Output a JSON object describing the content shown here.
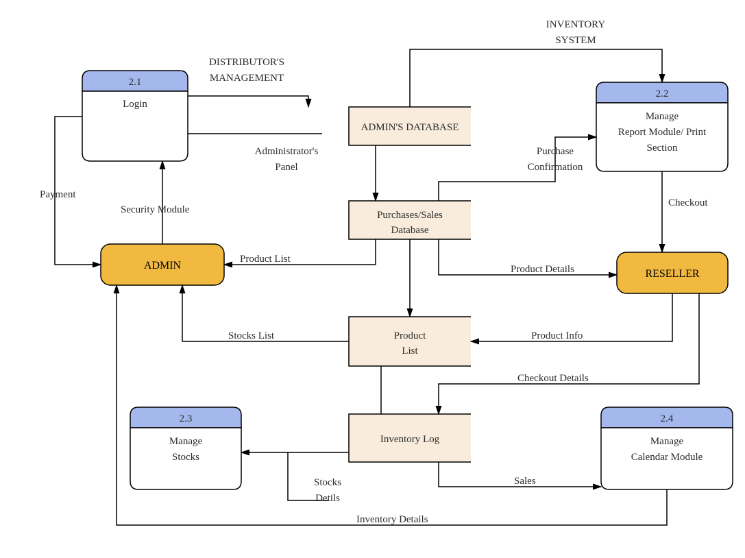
{
  "header1_line1": "DISTRIBUTOR'S",
  "header1_line2": "MANAGEMENT",
  "header2_line1": "INVENTORY",
  "header2_line2": "SYSTEM",
  "p21_num": "2.1",
  "p21_label": "Login",
  "p22_num": "2.2",
  "p22_l1": "Manage",
  "p22_l2": "Report Module/ Print",
  "p22_l3": "Section",
  "p23_num": "2.3",
  "p23_l1": "Manage",
  "p23_l2": "Stocks",
  "p24_num": "2.4",
  "p24_l1": "Manage",
  "p24_l2": "Calendar Module",
  "admin": "ADMIN",
  "reseller": "RESELLER",
  "admins_db": "ADMIN'S DATABASE",
  "ps_l1": "Purchases/Sales",
  "ps_l2": "Database",
  "pl_l1": "Product",
  "pl_l2": "List",
  "inv_log": "Inventory Log",
  "e_payment": "Payment",
  "e_security": "Security Module",
  "e_admin_panel_l1": "Administrator's",
  "e_admin_panel_l2": "Panel",
  "e_purch_conf_l1": "Purchase",
  "e_purch_conf_l2": "Confirmation",
  "e_checkout": "Checkout",
  "e_product_list": "Product List",
  "e_product_details": "Product Details",
  "e_product_info": "Product Info",
  "e_checkout_details": "Checkout Details",
  "e_stocks_list": "Stocks List",
  "e_stocks_det_l1": "Stocks",
  "e_stocks_det_l2": "Detils",
  "e_sales": "Sales",
  "e_inv_details": "Inventory Details"
}
